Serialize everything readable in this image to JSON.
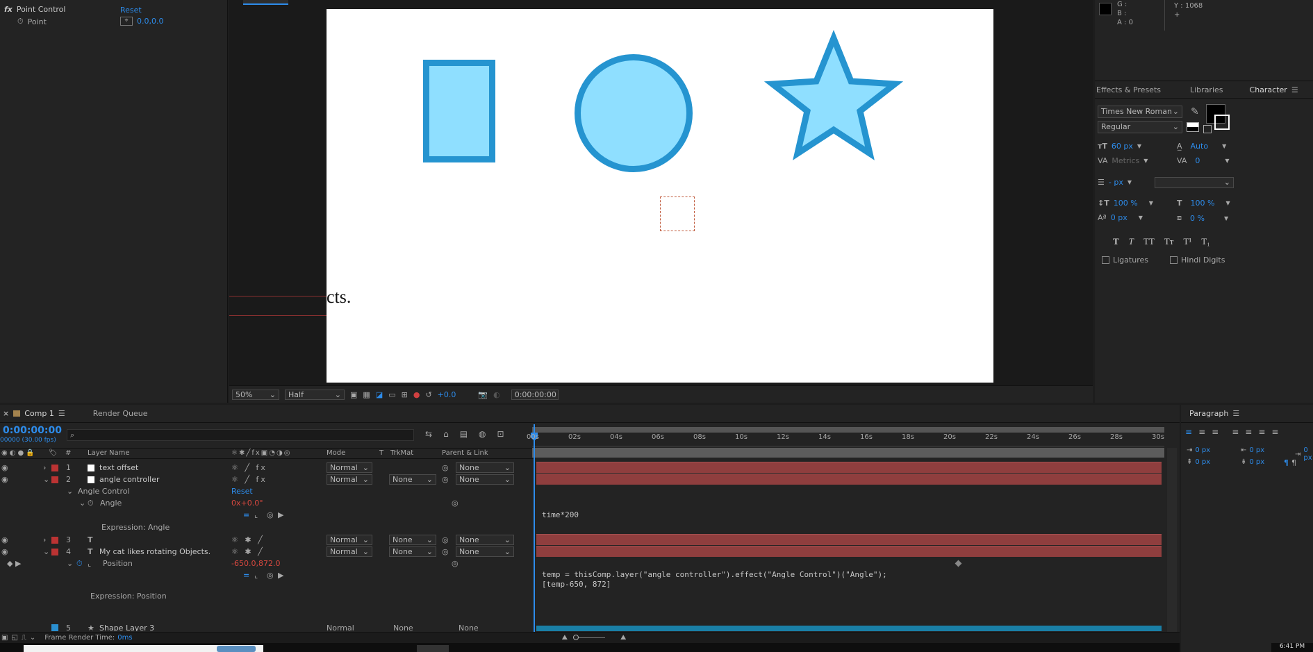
{
  "effects": {
    "point_control_label": "Point Control",
    "reset_label": "Reset",
    "point_label": "Point",
    "point_value": "0.0,0.0"
  },
  "viewer": {
    "tab_label": "Comp 1",
    "zoom": "50%",
    "resolution": "Half",
    "exposure": "+0.0",
    "timecode": "0:00:00:00",
    "canvas_text": "cts."
  },
  "info": {
    "g_label": "G :",
    "b_label": "B :",
    "a_label": "A : 0",
    "y_label": "Y : 1068"
  },
  "right_tabs": {
    "effects_presets": "Effects & Presets",
    "libraries": "Libraries",
    "character": "Character"
  },
  "character": {
    "font_family": "Times New Roman",
    "font_style": "Regular",
    "font_size": "60 px",
    "leading": "Auto",
    "kerning": "Metrics",
    "tracking": "0",
    "stroke_width": "- px",
    "vert_scale": "100 %",
    "horiz_scale": "100 %",
    "baseline_shift": "0 px",
    "tsume": "0 %",
    "ligatures_label": "Ligatures",
    "hindi_digits_label": "Hindi Digits",
    "style_buttons": [
      "T",
      "T",
      "TT",
      "Tт",
      "T¹",
      "T₁"
    ],
    "fill_color": "#000000"
  },
  "timeline": {
    "comp_tab": "Comp 1",
    "render_queue_tab": "Render Queue",
    "timecode": "0:00:00:00",
    "fps": "00000 (30.00 fps)",
    "search_placeholder": "",
    "col_layer_name": "Layer Name",
    "col_hash": "#",
    "col_mode": "Mode",
    "col_t": "T",
    "col_trkmat": "TrkMat",
    "col_parent": "Parent & Link",
    "ruler": [
      "00s",
      "02s",
      "04s",
      "06s",
      "08s",
      "10s",
      "12s",
      "14s",
      "16s",
      "18s",
      "20s",
      "22s",
      "24s",
      "26s",
      "28s",
      "30s"
    ],
    "layers": [
      {
        "num": "1",
        "name": "text offset",
        "mode": "Normal",
        "trkmat": "",
        "parent": "None"
      },
      {
        "num": "2",
        "name": "angle controller",
        "mode": "Normal",
        "trkmat": "None",
        "parent": "None"
      },
      {
        "num": "3",
        "name": "",
        "mode": "Normal",
        "trkmat": "None",
        "parent": "None"
      },
      {
        "num": "4",
        "name": "My cat likes rotating Objects.",
        "mode": "Normal",
        "trkmat": "None",
        "parent": "None"
      },
      {
        "num": "5",
        "name": "Shape Layer 3",
        "mode": "Normal",
        "trkmat": "None",
        "parent": "None"
      }
    ],
    "angle_control_label": "Angle Control",
    "reset_label": "Reset",
    "angle_label": "Angle",
    "angle_value": "0x+0.0°",
    "expr_angle_label": "Expression: Angle",
    "expr_angle_code": "time*200",
    "position_label": "Position",
    "position_value": "-650.0,872.0",
    "expr_position_label": "Expression: Position",
    "expr_position_line1": "temp = thisComp.layer(\"angle controller\").effect(\"Angle Control\")(\"Angle\");",
    "expr_position_line2": "[temp-650, 872]",
    "frame_render_label": "Frame Render Time:",
    "frame_render_value": "0ms"
  },
  "paragraph": {
    "title": "Paragraph",
    "indent_left": "0 px",
    "indent_right": "0 px",
    "first_line": "0 px",
    "space_before": "0 px",
    "space_after": "0 px"
  },
  "taskbar": {
    "time": "6:41 PM"
  }
}
